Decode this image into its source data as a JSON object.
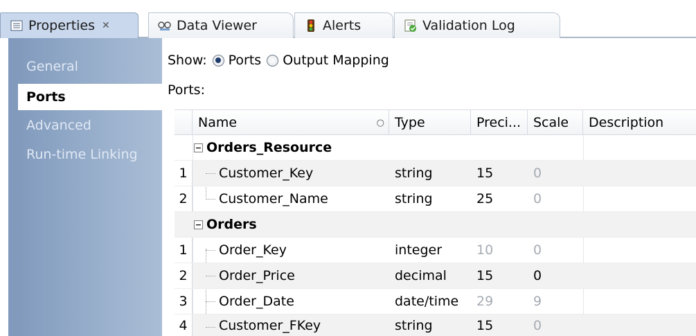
{
  "tabs": [
    {
      "label": "Properties",
      "icon": "properties-icon",
      "active": true,
      "close": "✕"
    },
    {
      "label": "Data Viewer",
      "icon": "data-viewer-icon",
      "active": false
    },
    {
      "label": "Alerts",
      "icon": "alerts-icon",
      "active": false
    },
    {
      "label": "Validation Log",
      "icon": "validation-log-icon",
      "active": false
    }
  ],
  "nav": {
    "items": [
      "General",
      "Ports",
      "Advanced",
      "Run-time Linking"
    ],
    "selected": "Ports"
  },
  "show": {
    "label": "Show:",
    "options": [
      "Ports",
      "Output Mapping"
    ],
    "selected": "Ports"
  },
  "ports_label": "Ports:",
  "table": {
    "columns": [
      "Name",
      "Type",
      "Preci...",
      "Scale",
      "Description"
    ],
    "groups": [
      {
        "name": "Orders_Resource",
        "rows": [
          {
            "num": "1",
            "name": "Customer_Key",
            "type": "string",
            "precision": "15",
            "scale": "0",
            "description": ""
          },
          {
            "num": "2",
            "name": "Customer_Name",
            "type": "string",
            "precision": "25",
            "scale": "0",
            "description": ""
          }
        ]
      },
      {
        "name": "Orders",
        "rows": [
          {
            "num": "1",
            "name": "Order_Key",
            "type": "integer",
            "precision": "10",
            "scale": "0",
            "description": ""
          },
          {
            "num": "2",
            "name": "Order_Price",
            "type": "decimal",
            "precision": "15",
            "scale": "0",
            "description": ""
          },
          {
            "num": "3",
            "name": "Order_Date",
            "type": "date/time",
            "precision": "29",
            "scale": "9",
            "description": ""
          },
          {
            "num": "4",
            "name": "Customer_FKey",
            "type": "string",
            "precision": "15",
            "scale": "0",
            "description": ""
          }
        ]
      }
    ]
  },
  "colors": {
    "nav_bg": "#8ea6c6",
    "active_tab_bg": "#c9d8ed",
    "dim_text": "#a6acb3",
    "row_alt": "#f2f2f2"
  }
}
